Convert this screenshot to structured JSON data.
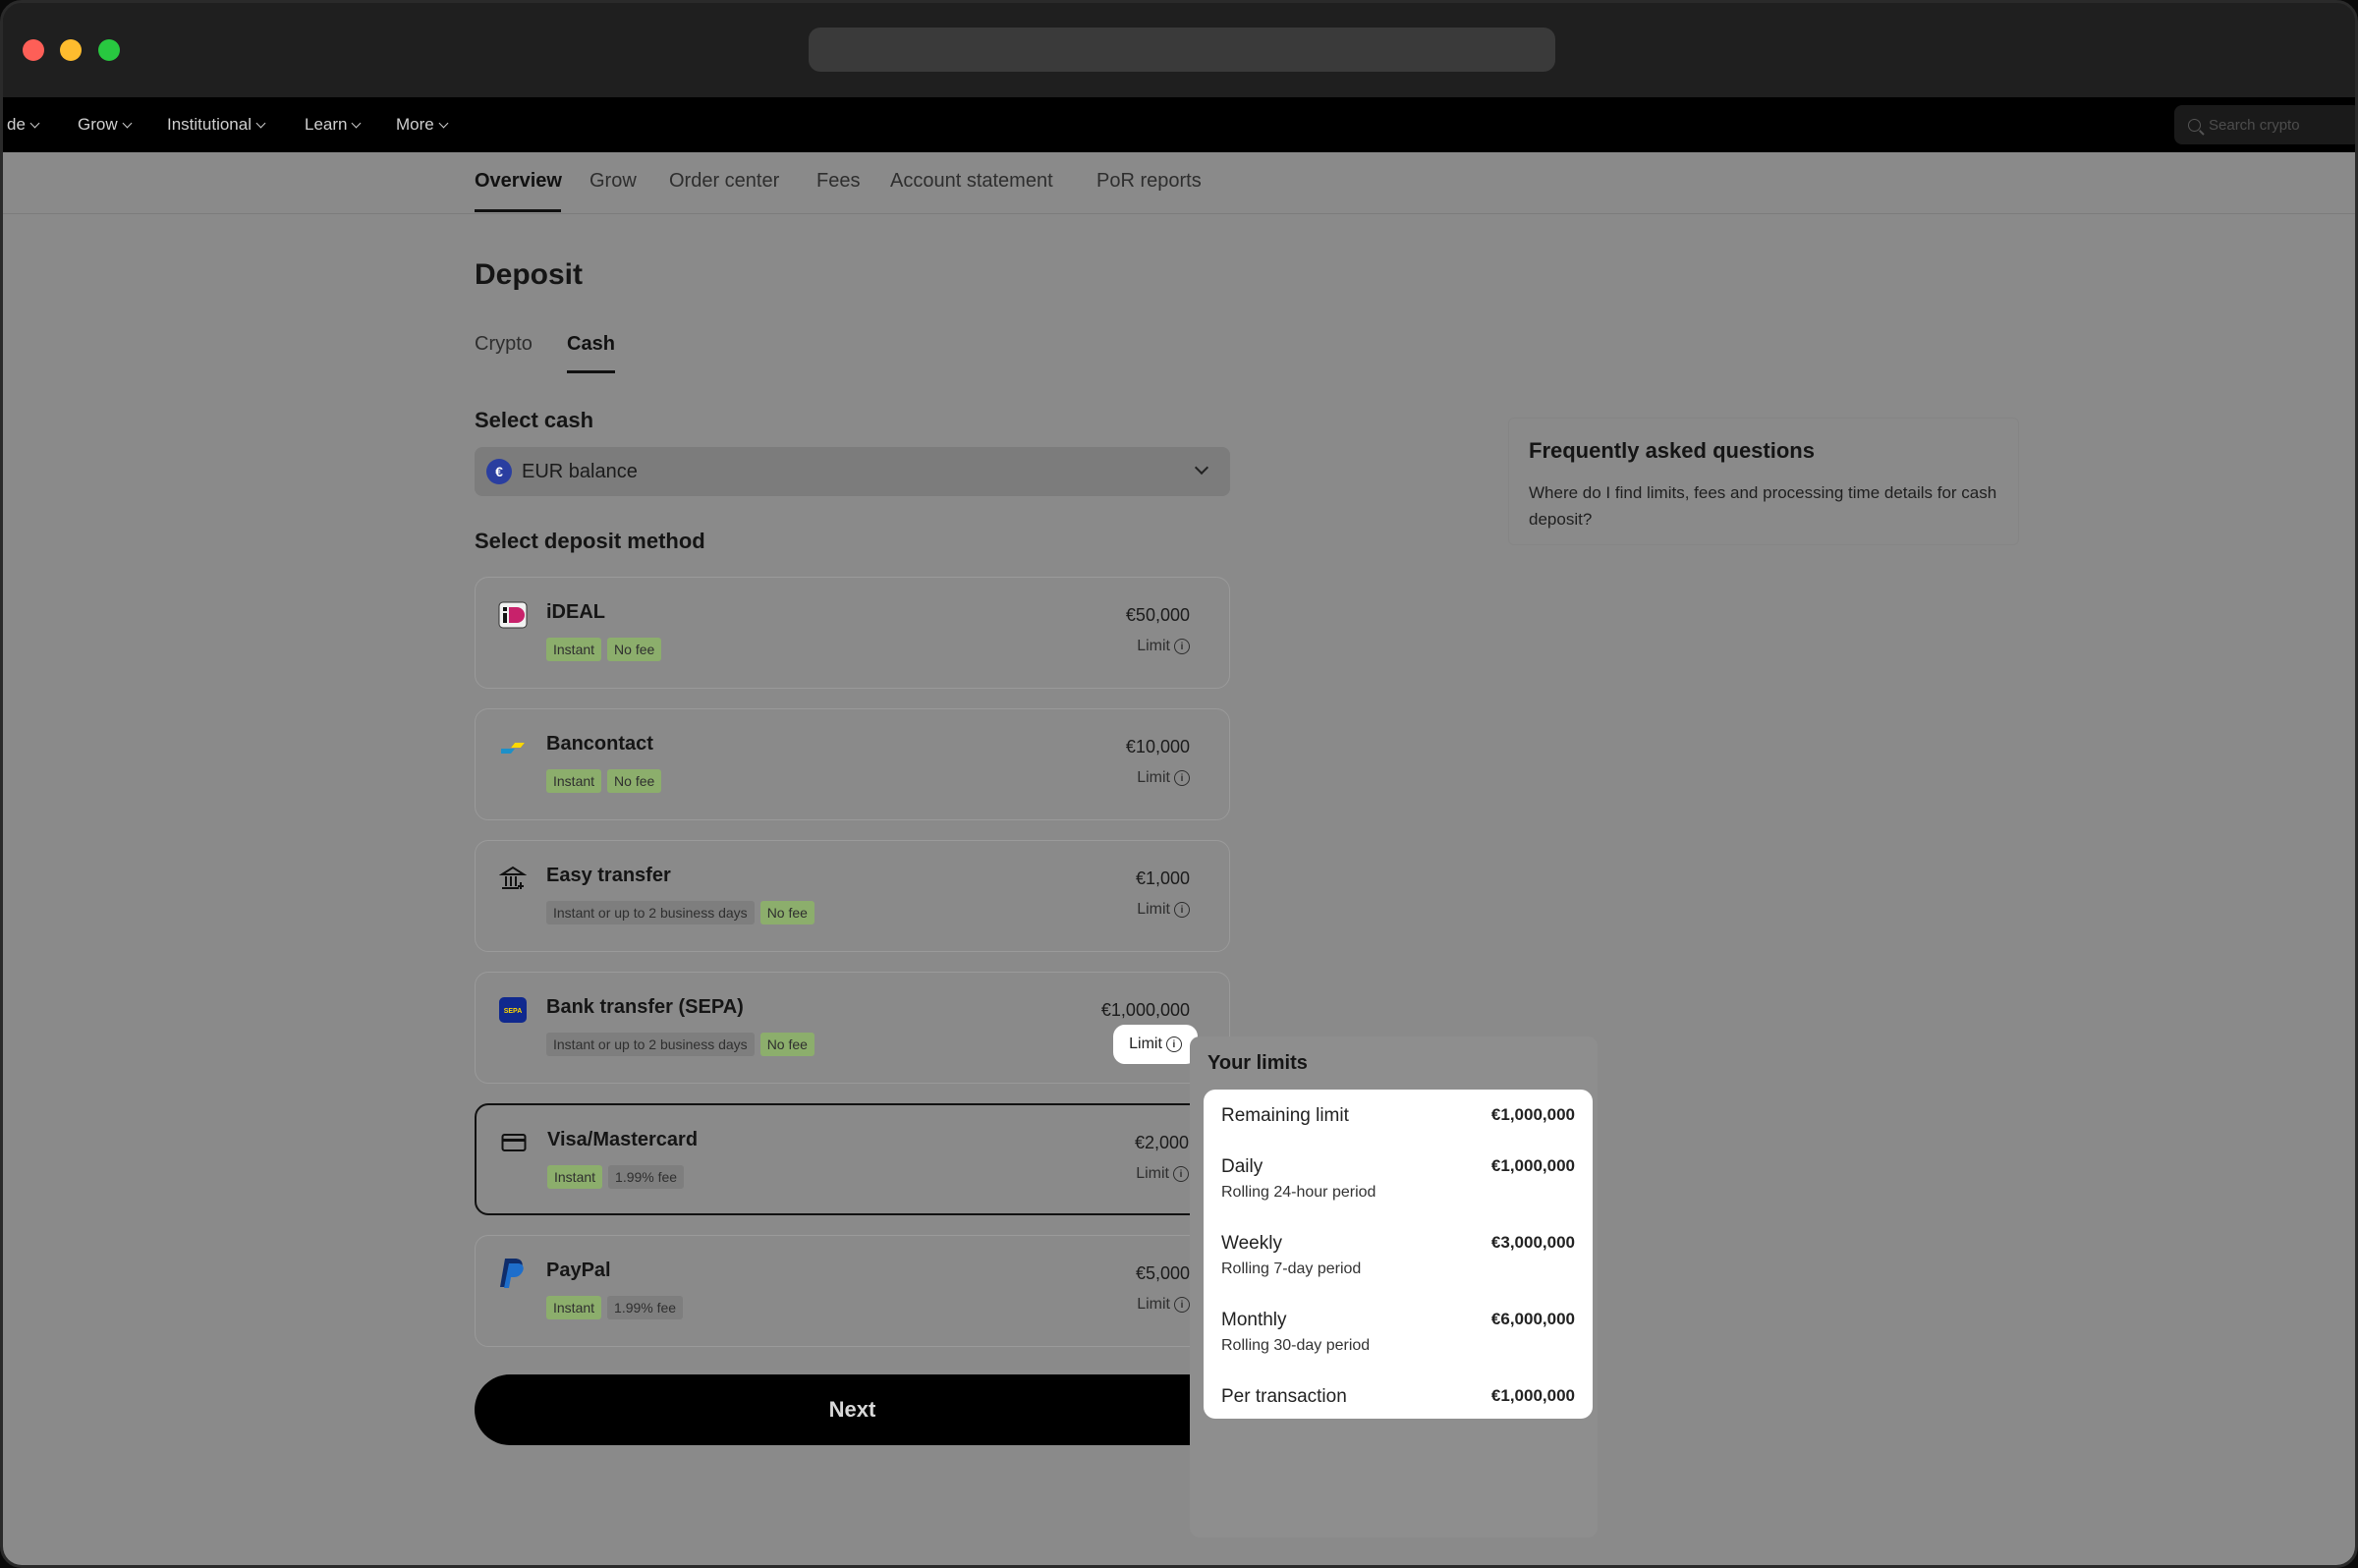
{
  "navbar": {
    "items": [
      "de",
      "Grow",
      "Institutional",
      "Learn",
      "More"
    ],
    "search_placeholder": "Search crypto"
  },
  "subnav": {
    "tabs": [
      "Overview",
      "Grow",
      "Order center",
      "Fees",
      "Account statement",
      "PoR reports"
    ],
    "active": "Overview"
  },
  "deposit": {
    "title": "Deposit",
    "tabs": [
      "Crypto",
      "Cash"
    ],
    "active_tab": "Cash",
    "select_cash_label": "Select cash",
    "select_cash_value": "EUR balance",
    "select_method_label": "Select deposit method",
    "methods": [
      {
        "name": "iDEAL",
        "tags": [
          "Instant",
          "No fee"
        ],
        "amount": "€50,000",
        "limit_label": "Limit",
        "icon": "ideal-icon"
      },
      {
        "name": "Bancontact",
        "tags": [
          "Instant",
          "No fee"
        ],
        "amount": "€10,000",
        "limit_label": "Limit",
        "icon": "bancontact-icon"
      },
      {
        "name": "Easy transfer",
        "tags": [
          "Instant or up to 2 business days",
          "No fee"
        ],
        "amount": "€1,000",
        "limit_label": "Limit",
        "icon": "bank-icon"
      },
      {
        "name": "Bank transfer (SEPA)",
        "tags": [
          "Instant or up to 2 business days",
          "No fee"
        ],
        "amount": "€1,000,000",
        "limit_label": "Limit",
        "icon": "sepa-icon"
      },
      {
        "name": "Visa/Mastercard",
        "tags": [
          "Instant",
          "1.99% fee"
        ],
        "amount": "€2,000",
        "limit_label": "Limit",
        "icon": "card-icon"
      },
      {
        "name": "PayPal",
        "tags": [
          "Instant",
          "1.99% fee"
        ],
        "amount": "€5,000",
        "limit_label": "Limit",
        "icon": "paypal-icon"
      }
    ],
    "next_label": "Next"
  },
  "faq": {
    "title": "Frequently asked questions",
    "question": "Where do I find limits, fees and processing time details for cash deposit?"
  },
  "limits_popover": {
    "title": "Your limits",
    "rows": [
      {
        "label": "Remaining limit",
        "sub": "",
        "value": "€1,000,000"
      },
      {
        "label": "Daily",
        "sub": "Rolling 24-hour period",
        "value": "€1,000,000"
      },
      {
        "label": "Weekly",
        "sub": "Rolling 7-day period",
        "value": "€3,000,000"
      },
      {
        "label": "Monthly",
        "sub": "Rolling 30-day period",
        "value": "€6,000,000"
      },
      {
        "label": "Per transaction",
        "sub": "",
        "value": "€1,000,000"
      }
    ]
  },
  "colors": {
    "tag_green": "#8cae6c",
    "tag_grey": "#7e7e7e",
    "eur_icon": "#2a3ea0"
  }
}
